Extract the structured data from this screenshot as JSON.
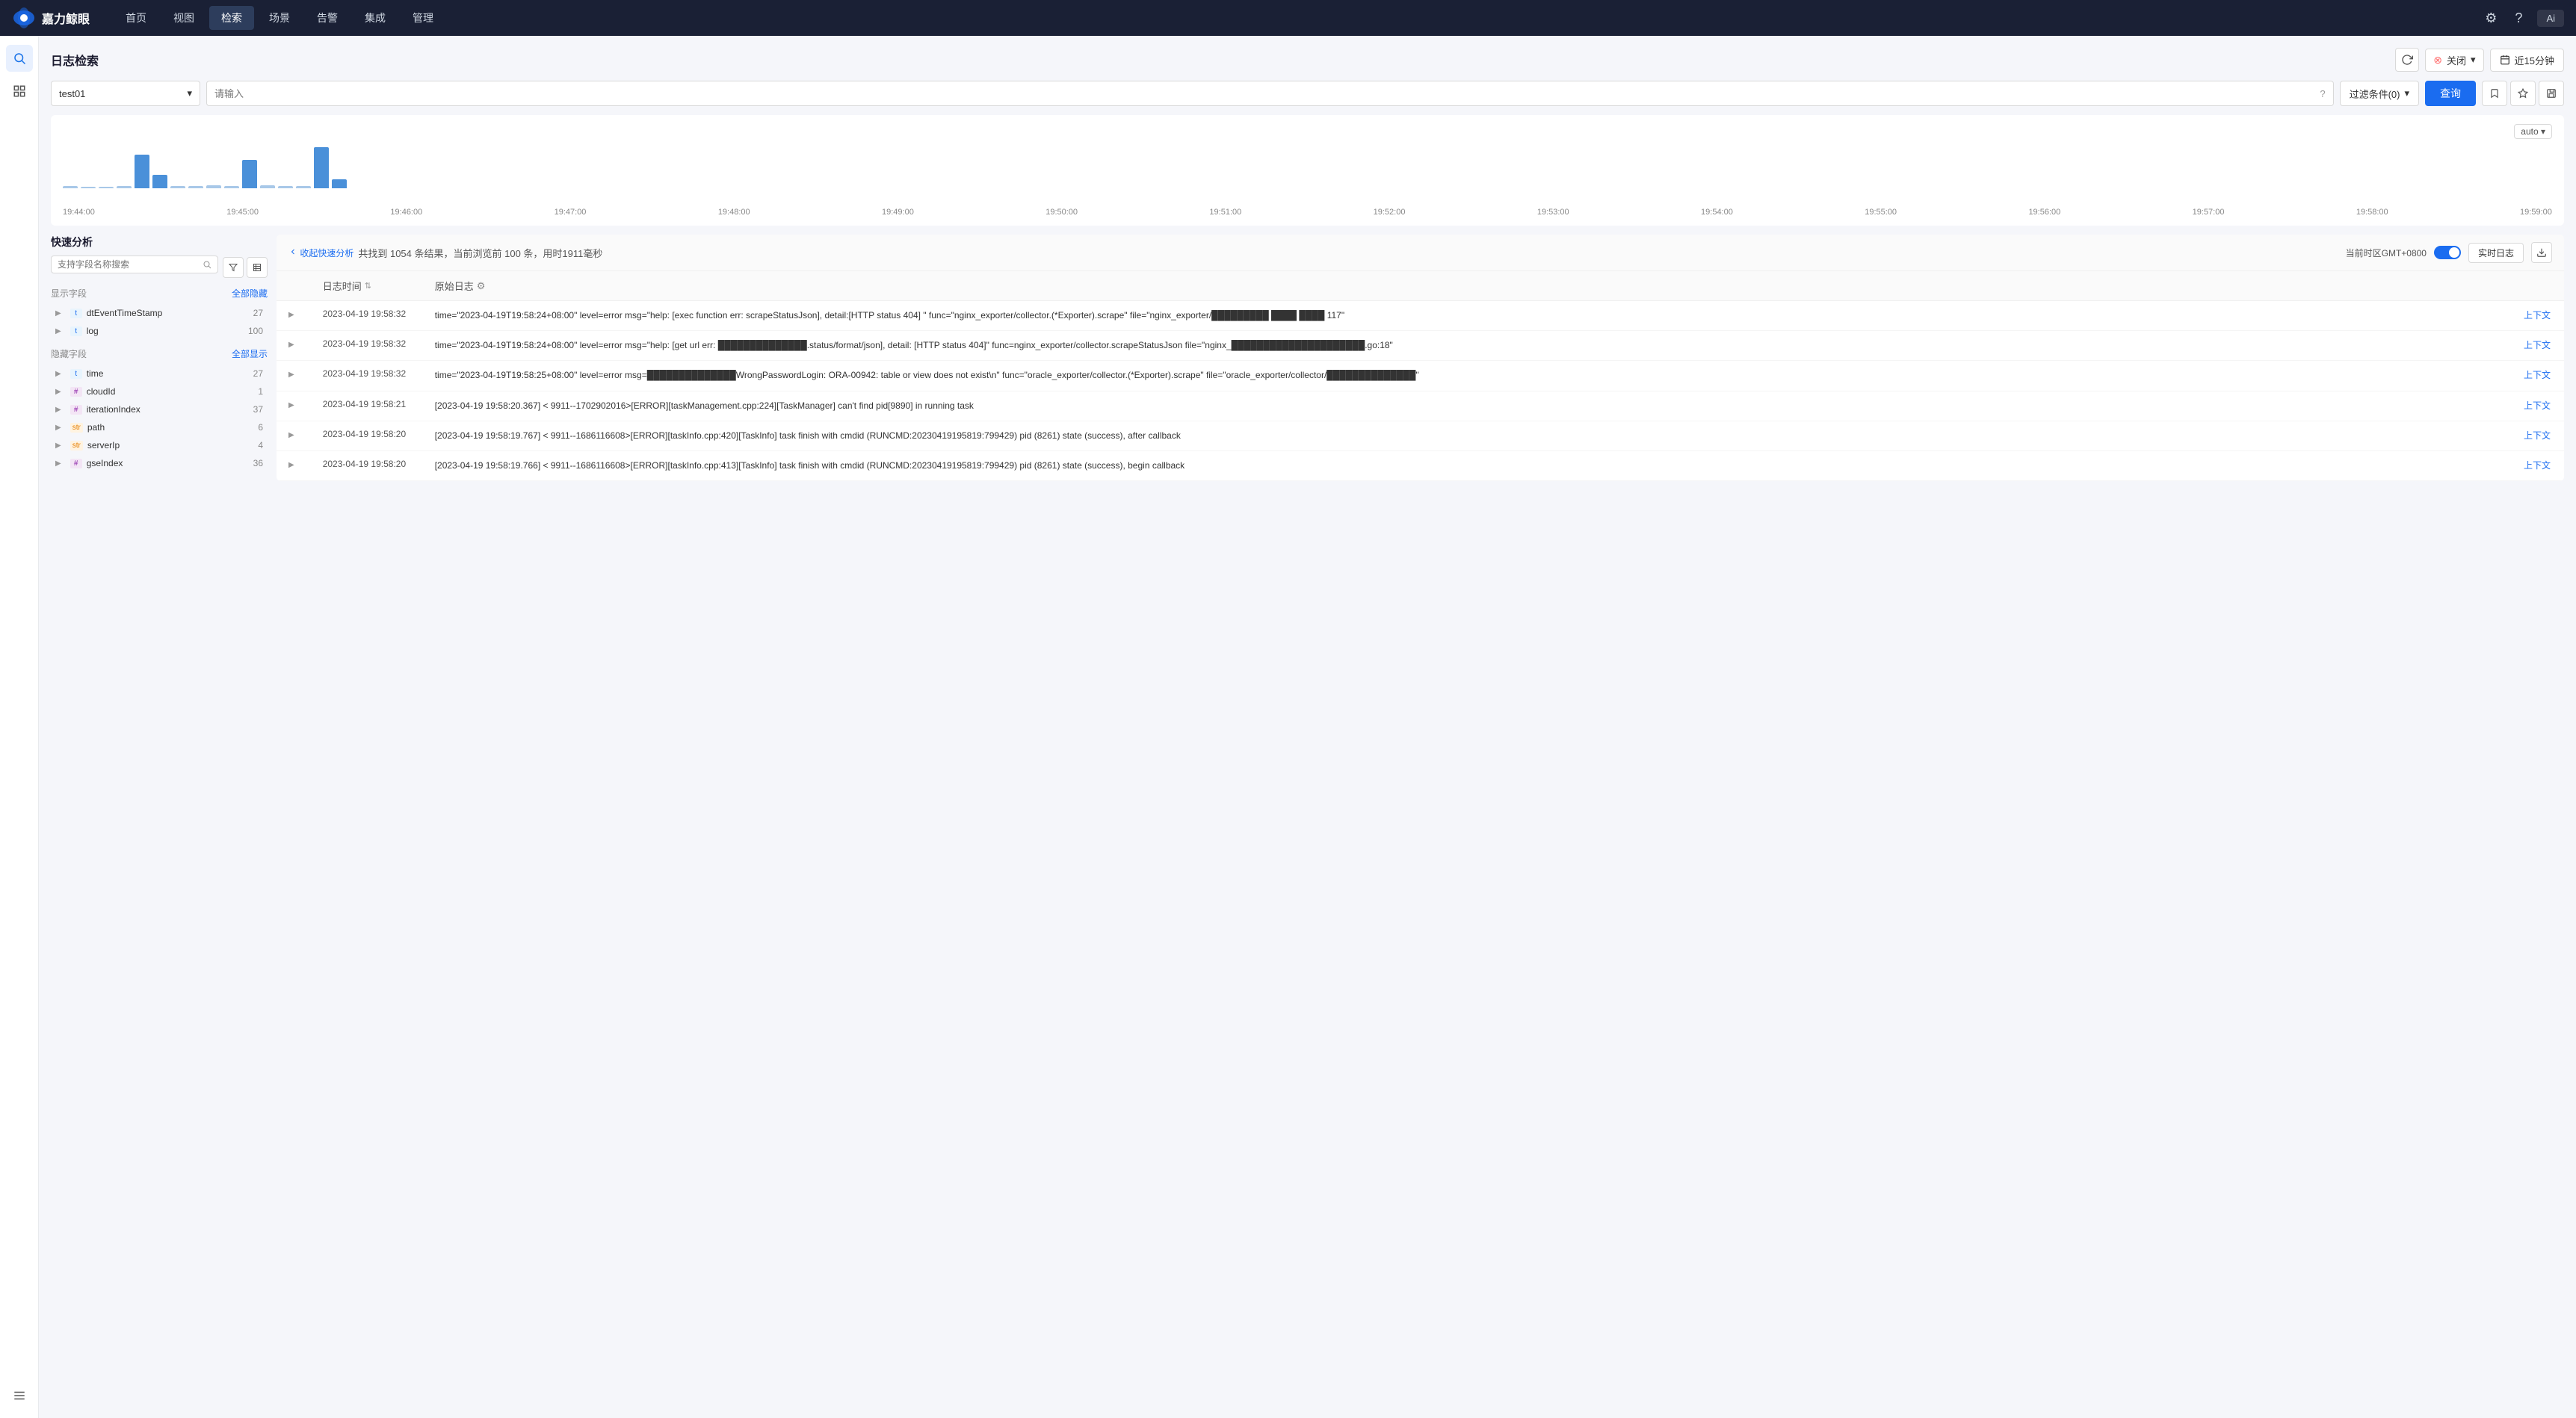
{
  "nav": {
    "logo_text": "嘉力鲸眼",
    "items": [
      {
        "label": "首页",
        "active": false
      },
      {
        "label": "视图",
        "active": false
      },
      {
        "label": "检索",
        "active": true
      },
      {
        "label": "场景",
        "active": false
      },
      {
        "label": "告警",
        "active": false
      },
      {
        "label": "集成",
        "active": false
      },
      {
        "label": "管理",
        "active": false
      }
    ],
    "user": "Ai"
  },
  "page": {
    "title": "日志检索",
    "status_label": "关闭",
    "time_range": "近15分钟",
    "refresh_label": "刷新"
  },
  "search": {
    "index": "test01",
    "placeholder": "请输入",
    "filter_label": "过滤条件(0)",
    "query_label": "查询",
    "auto_label": "auto ▾"
  },
  "chart": {
    "labels": [
      "19:44:00",
      "19:45:00",
      "19:46:00",
      "19:47:00",
      "19:48:00",
      "19:49:00",
      "19:50:00",
      "19:51:00",
      "19:52:00",
      "19:53:00",
      "19:54:00",
      "19:55:00",
      "19:56:00",
      "19:57:00",
      "19:58:00",
      "19:59:00"
    ],
    "bars": [
      3,
      2,
      2,
      3,
      45,
      18,
      3,
      3,
      4,
      3,
      38,
      4,
      3,
      3,
      55,
      12
    ]
  },
  "quick_analysis": {
    "title": "快速分析",
    "search_placeholder": "支持字段名称搜索",
    "collapse_link": "收起快速分析",
    "display_section_title": "显示字段",
    "display_section_toggle": "全部隐藏",
    "hidden_section_title": "隐藏字段",
    "hidden_section_toggle": "全部显示",
    "display_fields": [
      {
        "name": "dtEventTimeStamp",
        "type": "time",
        "type_label": "t",
        "count": 27
      },
      {
        "name": "log",
        "type": "str",
        "type_label": "t",
        "count": 100
      }
    ],
    "hidden_fields": [
      {
        "name": "time",
        "type": "time",
        "type_label": "t",
        "count": 27
      },
      {
        "name": "cloudId",
        "type": "num",
        "type_label": "#",
        "count": 1
      },
      {
        "name": "iterationIndex",
        "type": "num",
        "type_label": "#",
        "count": 37
      },
      {
        "name": "path",
        "type": "str",
        "type_label": "str",
        "count": 6
      },
      {
        "name": "serverIp",
        "type": "str",
        "type_label": "str",
        "count": 4
      },
      {
        "name": "gseIndex",
        "type": "num",
        "type_label": "#",
        "count": 36
      }
    ]
  },
  "results": {
    "collapse_link": "收起快速分析",
    "total": "1054",
    "current": "100",
    "time_ms": "1911",
    "summary": "共找到 1054 条结果，当前浏览前 100 条，用时1911毫秒",
    "timezone": "当前时区GMT+0800",
    "realtime_label": "实时日志",
    "col_time": "日志时间",
    "col_log": "原始日志",
    "rows": [
      {
        "time": "2023-04-19 19:58:32",
        "content": "time=\"2023-04-19T19:58:24+08:00\" level=error msg=\"help: [exec function err: scrapeStatusJson], detail:[HTTP status 404] \" func=\"nginx_exporter/collector.(*Exporter).scrape\" file=\"nginx_exporter/█████████ ████ ████ 117\"",
        "action": "上下文"
      },
      {
        "time": "2023-04-19 19:58:32",
        "content": "time=\"2023-04-19T19:58:24+08:00\" level=error msg=\"help: [get url err: ██████████████.status/format/json], detail: [HTTP status 404]\" func=nginx_exporter/collector.scrapeStatusJson file=\"nginx_█████████████████████.go:18\"",
        "action": "上下文"
      },
      {
        "time": "2023-04-19 19:58:32",
        "content": "time=\"2023-04-19T19:58:25+08:00\" level=error msg=██████████████WrongPasswordLogin: ORA-00942: table or view does not exist\\n\" func=\"oracle_exporter/collector.(*Exporter).scrape\" file=\"oracle_exporter/collector/██████████████\"",
        "action": "上下文"
      },
      {
        "time": "2023-04-19 19:58:21",
        "content": "[2023-04-19 19:58:20.367] < 9911--1702902016>[ERROR][taskManagement.cpp:224][TaskManager] can't find pid[9890] in running task",
        "action": "上下文"
      },
      {
        "time": "2023-04-19 19:58:20",
        "content": "[2023-04-19 19:58:19.767] < 9911--1686116608>[ERROR][taskInfo.cpp:420][TaskInfo] task finish with cmdid (RUNCMD:20230419195819:799429) pid (8261) state  (success), after callback",
        "action": "上下文"
      },
      {
        "time": "2023-04-19 19:58:20",
        "content": "[2023-04-19 19:58:19.766] < 9911--1686116608>[ERROR][taskInfo.cpp:413][TaskInfo] task finish with cmdid (RUNCMD:20230419195819:799429) pid (8261) state  (success), begin callback",
        "action": "上下文"
      }
    ]
  }
}
